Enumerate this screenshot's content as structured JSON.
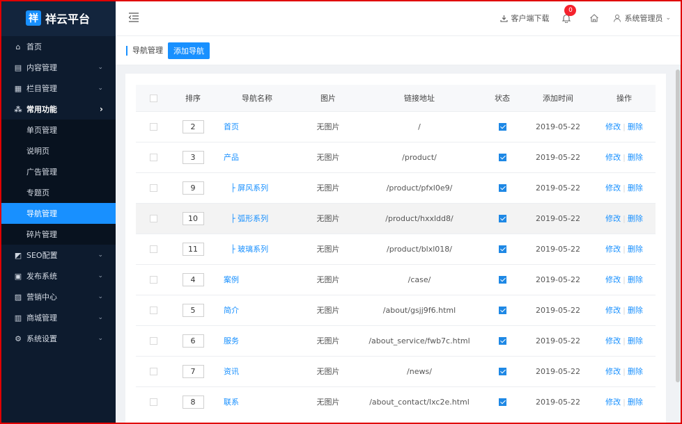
{
  "app": {
    "logo_char": "祥",
    "title": "祥云平台"
  },
  "sidebar": {
    "items": [
      {
        "label": "首页",
        "icon": "home-icon",
        "glyph": "⌂"
      },
      {
        "label": "内容管理",
        "icon": "content-icon",
        "glyph": "▤"
      },
      {
        "label": "栏目管理",
        "icon": "column-icon",
        "glyph": "▦"
      },
      {
        "label": "常用功能",
        "icon": "grid-icon",
        "glyph": "⁂"
      },
      {
        "label": "单页管理"
      },
      {
        "label": "说明页"
      },
      {
        "label": "广告管理"
      },
      {
        "label": "专题页"
      },
      {
        "label": "导航管理"
      },
      {
        "label": "碎片管理"
      },
      {
        "label": "SEO配置",
        "icon": "seo-icon",
        "glyph": "◩"
      },
      {
        "label": "发布系统",
        "icon": "publish-icon",
        "glyph": "▣"
      },
      {
        "label": "营销中心",
        "icon": "marketing-icon",
        "glyph": "▨"
      },
      {
        "label": "商城管理",
        "icon": "shop-icon",
        "glyph": "▥"
      },
      {
        "label": "系统设置",
        "icon": "settings-icon",
        "glyph": "⚙"
      }
    ]
  },
  "header": {
    "download_label": "客户端下载",
    "notification_count": "0",
    "user_label": "系统管理员"
  },
  "crumbbar": {
    "title": "导航管理",
    "add_label": "添加导航"
  },
  "table": {
    "headers": {
      "sort": "排序",
      "name": "导航名称",
      "image": "图片",
      "link": "链接地址",
      "status": "状态",
      "time": "添加时间",
      "ops": "操作"
    },
    "edit_label": "修改",
    "delete_label": "删除",
    "rows": [
      {
        "sort": "2",
        "name": "首页",
        "image": "无图片",
        "link": "/",
        "time": "2019-05-22"
      },
      {
        "sort": "3",
        "name": "产品",
        "image": "无图片",
        "link": "/product/",
        "time": "2019-05-22"
      },
      {
        "sort": "9",
        "name": "├ 屏风系列",
        "image": "无图片",
        "link": "/product/pfxl0e9/",
        "time": "2019-05-22"
      },
      {
        "sort": "10",
        "name": "├ 弧形系列",
        "image": "无图片",
        "link": "/product/hxxldd8/",
        "time": "2019-05-22"
      },
      {
        "sort": "11",
        "name": "├ 玻璃系列",
        "image": "无图片",
        "link": "/product/blxl018/",
        "time": "2019-05-22"
      },
      {
        "sort": "4",
        "name": "案例",
        "image": "无图片",
        "link": "/case/",
        "time": "2019-05-22"
      },
      {
        "sort": "5",
        "name": "简介",
        "image": "无图片",
        "link": "/about/gsjj9f6.html",
        "time": "2019-05-22"
      },
      {
        "sort": "6",
        "name": "服务",
        "image": "无图片",
        "link": "/about_service/fwb7c.html",
        "time": "2019-05-22"
      },
      {
        "sort": "7",
        "name": "资讯",
        "image": "无图片",
        "link": "/news/",
        "time": "2019-05-22"
      },
      {
        "sort": "8",
        "name": "联系",
        "image": "无图片",
        "link": "/about_contact/lxc2e.html",
        "time": "2019-05-22"
      }
    ]
  }
}
